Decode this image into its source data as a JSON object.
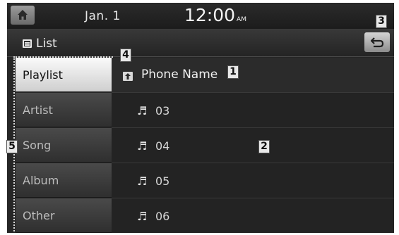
{
  "status": {
    "date": "Jan.  1",
    "time": "12:00",
    "ampm": "AM"
  },
  "header": {
    "list_label": "List"
  },
  "callouts": {
    "one": "1",
    "two": "2",
    "three": "3",
    "four": "4",
    "five": "5"
  },
  "sidebar": {
    "items": [
      {
        "label": "Playlist",
        "active": true
      },
      {
        "label": "Artist"
      },
      {
        "label": "Song"
      },
      {
        "label": "Album"
      },
      {
        "label": "Other"
      }
    ]
  },
  "content": {
    "folder_name": "Phone Name",
    "tracks": [
      "03",
      "04",
      "05",
      "06"
    ],
    "note_glyph": "♬"
  },
  "icons": {
    "home": "home-icon",
    "list": "list-icon",
    "back": "back-icon",
    "folder_up": "folder-up-icon",
    "note": "music-note-icon"
  }
}
